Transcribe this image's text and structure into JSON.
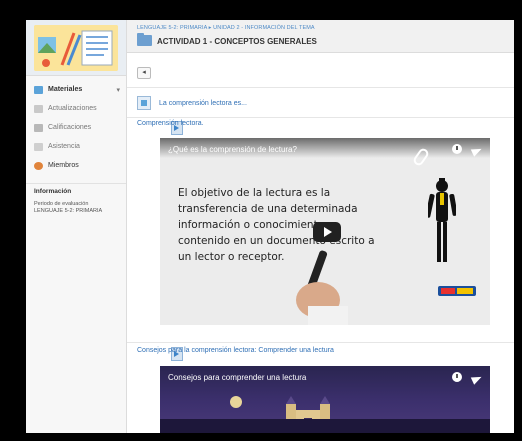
{
  "sidebar": {
    "items": [
      {
        "label": "Materiales",
        "icon": "materials-icon",
        "active": true
      },
      {
        "label": "Actualizaciones",
        "icon": "updates-icon"
      },
      {
        "label": "Calificaciones",
        "icon": "grades-icon"
      },
      {
        "label": "Asistencia",
        "icon": "attendance-icon"
      },
      {
        "label": "Miembros",
        "icon": "members-icon"
      }
    ],
    "info_title": "Información",
    "info_lines": [
      "Periodo de evaluación",
      "LENGUAJE 5-2: PRIMARIA"
    ]
  },
  "header": {
    "breadcrumb": "LENGUAJE 5-2: PRIMARIA ▸ UNIDAD 2 - INFORMACIÓN DEL TEMA",
    "title": "ACTIVIDAD 1 - CONCEPTOS GENERALES"
  },
  "toolbar": {
    "back_label": "◂"
  },
  "materials": [
    {
      "title": "La comprensión lectora es...",
      "type": "page"
    },
    {
      "title": "Comprensión lectora.",
      "type": "video"
    },
    {
      "title": "Consejos para la comprensión lectora: Comprender una lectura",
      "type": "video"
    }
  ],
  "videos": [
    {
      "title": "¿Qué es la comprensión de lectura?",
      "board_lines": [
        "El objetivo de la lectura es la",
        "transferencia de una determinada",
        "información o conocimiento,",
        "contenido en un documento escrito a",
        "un lector o receptor."
      ]
    },
    {
      "title": "Consejos para comprender una lectura"
    }
  ],
  "colors": {
    "accent": "#2f6fb5",
    "sidebar_bg": "#f7f7f7",
    "topbar_bg": "#f1f1f1"
  }
}
